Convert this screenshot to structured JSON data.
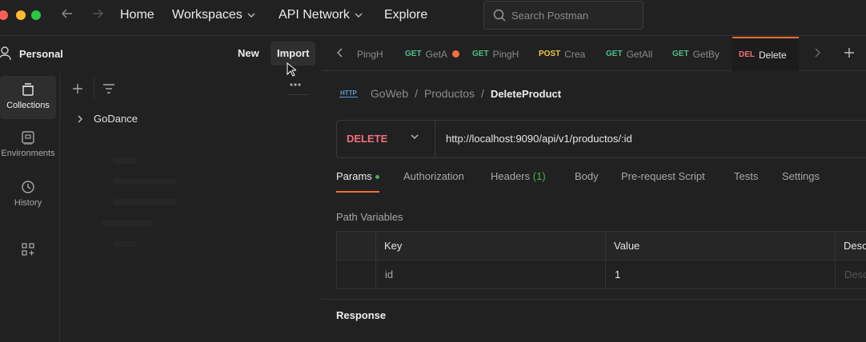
{
  "topbar": {
    "nav": {
      "home": "Home",
      "workspaces": "Workspaces",
      "api_network": "API Network",
      "explore": "Explore"
    },
    "search_placeholder": "Search Postman"
  },
  "workspace": {
    "name": "Personal",
    "new_label": "New",
    "import_label": "Import"
  },
  "rail": {
    "items": [
      {
        "label": "Collections",
        "icon": "collections-icon"
      },
      {
        "label": "Environments",
        "icon": "environments-icon"
      },
      {
        "label": "History",
        "icon": "history-icon"
      },
      {
        "label": "",
        "icon": "add-workbench-icon"
      }
    ]
  },
  "collections": {
    "items": [
      {
        "name": "GoDance"
      }
    ]
  },
  "tabs": [
    {
      "method": "",
      "name": "PingH"
    },
    {
      "method": "GET",
      "name": "GetA",
      "unsaved": true
    },
    {
      "method": "GET",
      "name": "PingH"
    },
    {
      "method": "POST",
      "name": "Crea"
    },
    {
      "method": "GET",
      "name": "GetAll"
    },
    {
      "method": "GET",
      "name": "GetBy"
    },
    {
      "method": "DEL",
      "name": "Delete",
      "active": true
    }
  ],
  "breadcrumb": {
    "badge": "HTTP",
    "parts": [
      "GoWeb",
      "Productos"
    ],
    "separator": "/",
    "current": "DeleteProduct"
  },
  "request": {
    "method": "DELETE",
    "url": "http://localhost:9090/api/v1/productos/:id"
  },
  "request_tabs": [
    {
      "label": "Params",
      "active": true
    },
    {
      "label": "Authorization"
    },
    {
      "label": "Headers",
      "count": "(1)"
    },
    {
      "label": "Body"
    },
    {
      "label": "Pre-request Script"
    },
    {
      "label": "Tests"
    },
    {
      "label": "Settings"
    }
  ],
  "path_variables": {
    "title": "Path Variables",
    "headers": {
      "key": "Key",
      "value": "Value",
      "description": "Desc"
    },
    "rows": [
      {
        "key": "id",
        "value": "1",
        "description_placeholder": "Desc"
      }
    ]
  },
  "response": {
    "title": "Response"
  },
  "colors": {
    "accent": "#ff6c37",
    "get": "#4fbf88",
    "post": "#f4c542",
    "delete": "#f0707b",
    "unsaved_dot": "#ff6c37"
  }
}
